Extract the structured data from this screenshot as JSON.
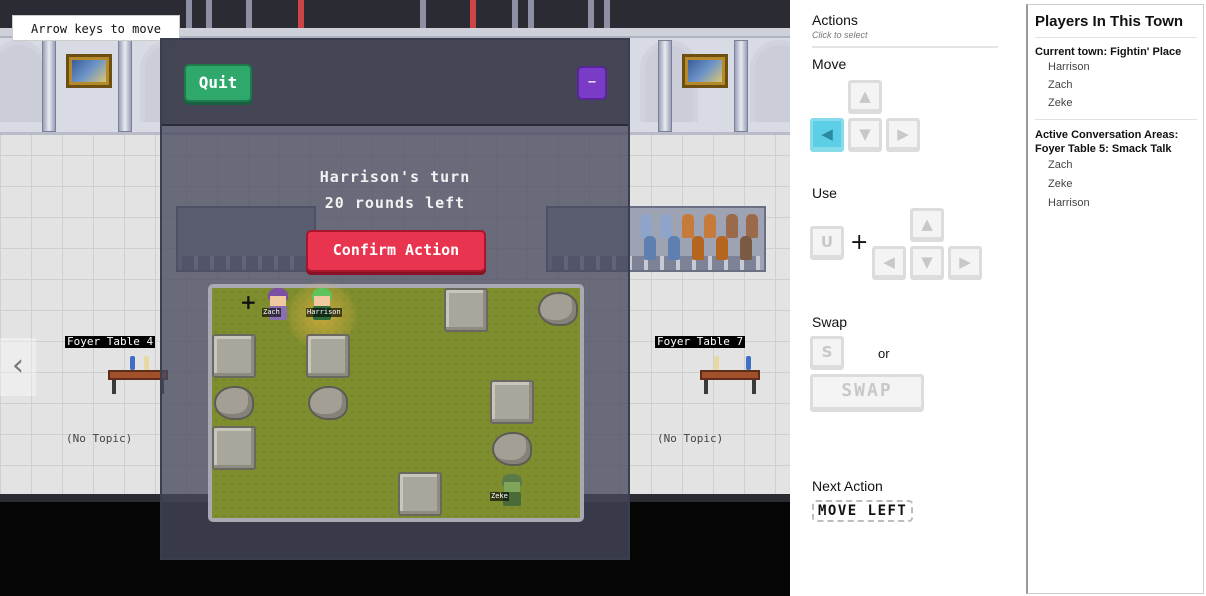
{
  "game": {
    "hint": "Arrow keys to move",
    "left_chevron": "‹",
    "tables": [
      {
        "label": "Foyer Table 4",
        "topic": "(No Topic)"
      },
      {
        "label": "Foyer Table 7",
        "topic": "(No Topic)"
      }
    ],
    "overlay": {
      "quit_label": "Quit",
      "minimize_label": "–",
      "turn_text": "Harrison's turn",
      "rounds_text": "20 rounds left",
      "confirm_label": "Confirm Action",
      "players_on_board": [
        "Zach",
        "Harrison",
        "Zeke"
      ]
    }
  },
  "controls": {
    "title": "Actions",
    "subtitle": "Click to select",
    "move_label": "Move",
    "use_label": "Use",
    "swap_label": "Swap",
    "or_label": "or",
    "use_key": "U",
    "swap_key": "S",
    "swap_wide": "SWAP",
    "arrow_up": "▲",
    "arrow_down": "▼",
    "arrow_left": "◀",
    "arrow_right": "▶",
    "plus": "+",
    "next_action_label": "Next Action",
    "next_action_value": "MOVE LEFT",
    "active_key": "arrow-left-key",
    "active_color": "#5ccfe6"
  },
  "players": {
    "title": "Players In This Town",
    "town_heading": "Current town: Fightin' Place",
    "town_players": [
      "Harrison",
      "Zach",
      "Zeke"
    ],
    "areas_heading": "Active Conversation Areas:",
    "area_name": "Foyer Table 5: Smack Talk",
    "area_players": [
      "Zach",
      "Zeke",
      "Harrison"
    ]
  }
}
